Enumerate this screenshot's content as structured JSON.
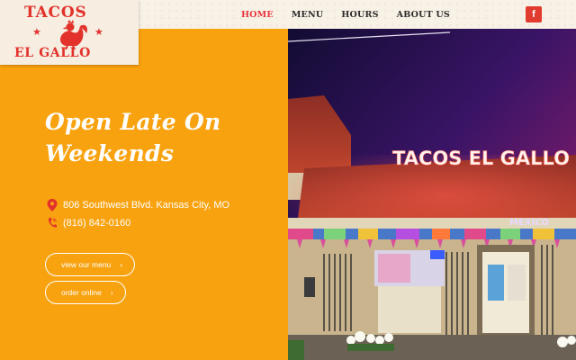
{
  "brand": {
    "logo_top": "TACOS",
    "logo_bottom": "EL GALLO"
  },
  "nav": {
    "items": [
      {
        "label": "HOME",
        "active": true
      },
      {
        "label": "MENU",
        "active": false
      },
      {
        "label": "HOURS",
        "active": false
      },
      {
        "label": "ABOUT US",
        "active": false
      }
    ],
    "facebook_glyph": "f"
  },
  "hero": {
    "headline": "Open Late On Weekends",
    "address": "806 Southwest Blvd. Kansas City, MO",
    "phone": "(816) 842-0160",
    "menu_button": "view our menu",
    "order_button": "order online",
    "button_chevron": "›"
  },
  "photo": {
    "sign_text": "TACOS EL GALLO",
    "banner_text": "MEXICO"
  },
  "colors": {
    "accent": "#e8343c",
    "panel": "#f9a20f",
    "nav_text": "#2b2b2b"
  },
  "icons": [
    "facebook-icon",
    "map-pin-icon",
    "phone-icon",
    "chevron-right-icon",
    "rooster-icon"
  ]
}
